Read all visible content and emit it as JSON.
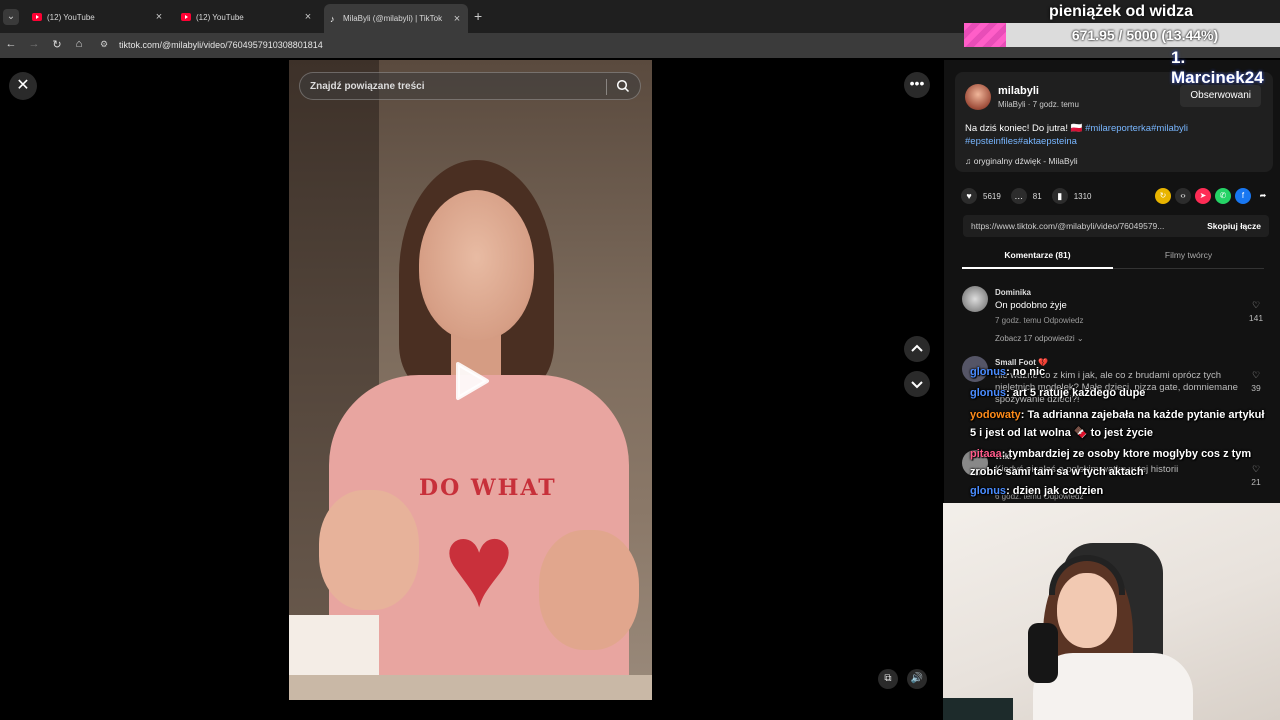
{
  "browser": {
    "tabs": [
      {
        "title": "(12) YouTube",
        "active": false
      },
      {
        "title": "(12) YouTube",
        "active": false
      },
      {
        "title": "MilaByli (@milabyli) | TikTok",
        "active": true
      }
    ],
    "new_tab_label": "+",
    "url": "tiktok.com/@milabyli/video/7604957910308801814"
  },
  "video": {
    "search_placeholder": "Znajdź powiązane treści",
    "shirt_print": "DO WHAT"
  },
  "post": {
    "username": "milabyli",
    "subline": "MilaByli · 7 godz. temu",
    "follow_label": "Obserwowani",
    "description_plain": "Na dziś koniec! Do jutra! 🇵🇱 ",
    "description_tags": "#milareporterka#milabyli #epsteinfiles#aktaepsteina",
    "sound": "oryginalny dźwięk - MilaByli",
    "likes": "5619",
    "comments": "81",
    "saves": "1310",
    "link": "https://www.tiktok.com/@milabyli/video/76049579...",
    "copy_label": "Skopiuj łącze",
    "tab_comments": "Komentarze (81)",
    "tab_creator": "Filmy twórcy"
  },
  "comments": [
    {
      "name": "Dominika",
      "text": "On podobno żyje",
      "meta": "7 godz. temu    Odpowiedz",
      "replies": "Zobacz 17 odpowiedzi ⌄",
      "likes": "141"
    },
    {
      "name": "Small Foot 💔",
      "text": "nie ważne co z kim i jak, ale co z brudami oprócz tych nieletnich modelek? Małe dzieci, pizza gate, domniemane spożywanie dzieci?!",
      "likes": "39"
    },
    {
      "name": "Wiki",
      "text": "Kiedyś pisałaś o polskim wątku w tej historii",
      "meta": "6 godz. temu    Odpowiedz",
      "likes": "21"
    }
  ],
  "overlay": {
    "donation_title": "pieniążek od widza",
    "donation_amount": "671.95 / 5000 (13.44%)",
    "donation_progress": 0.1344,
    "top_donor": "1. Marcinek24",
    "chat": [
      {
        "user": "glonus",
        "text": ": no nic"
      },
      {
        "user": "glonus",
        "text": ": art 5 ratuje każdego dupe"
      },
      {
        "user": "yodowaty",
        "text": ": Ta adrianna zajebała na każde pytanie artykuł 5 i jest od lat wolna 🍫 to jest życie"
      },
      {
        "user": "pitaaa",
        "text": ": tymbardziej ze osoby ktore moglyby cos z tym zrobic sami tam sa w tych aktach"
      },
      {
        "user": "glonus",
        "text": ": dzien jak codzien"
      }
    ]
  },
  "colors": {
    "accent_link": "#78b6ff",
    "donation_fill": "#ff5ec8",
    "chat_user_blue": "#4a8cff",
    "chat_user_orange": "#ff8c1a",
    "chat_user_pink": "#ff5a8a"
  }
}
